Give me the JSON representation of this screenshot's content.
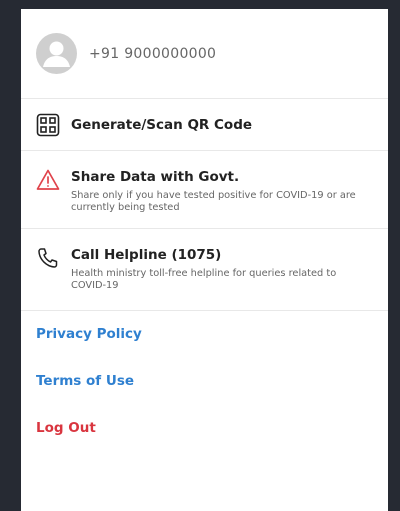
{
  "profile": {
    "phone": "+91 9000000000"
  },
  "menu": {
    "qr": {
      "title": "Generate/Scan QR Code"
    },
    "share": {
      "title": "Share Data with Govt.",
      "subtitle": "Share only if you have tested positive for COVID-19 or are currently being tested"
    },
    "helpline": {
      "title": "Call Helpline (1075)",
      "subtitle": "Health ministry toll-free helpline for queries related to COVID-19"
    }
  },
  "links": {
    "privacy": "Privacy Policy",
    "terms": "Terms of Use",
    "logout": "Log Out"
  },
  "colors": {
    "link_blue": "#2f80d0",
    "logout_red": "#d9353f",
    "warning_red": "#e0434b"
  }
}
